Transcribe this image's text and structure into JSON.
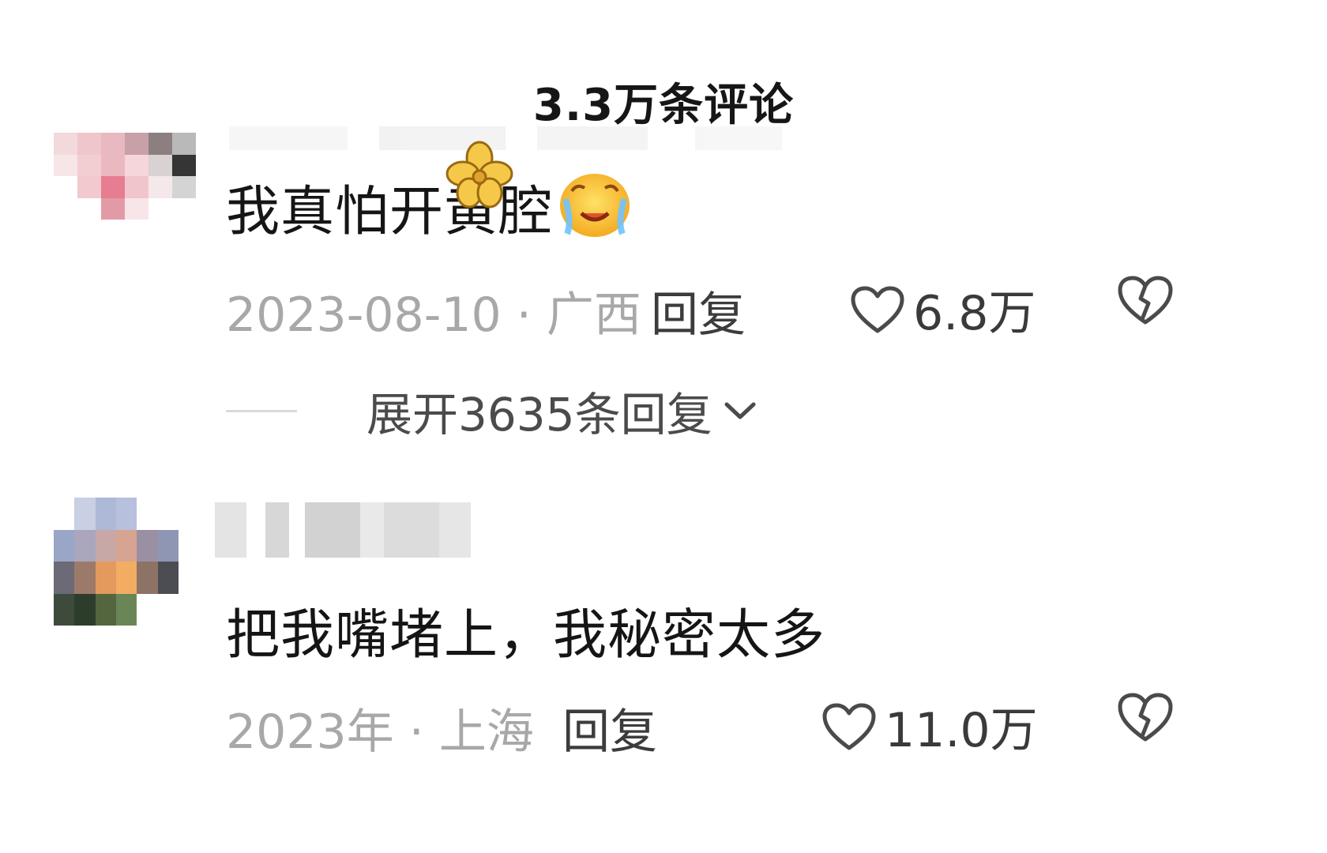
{
  "header": {
    "title": "3.3万条评论"
  },
  "comments": [
    {
      "text": "我真怕开黄腔",
      "date_location": "2023-08-10 · 广西",
      "reply_label": "回复",
      "likes": "6.8万",
      "expand_label": "展开3635条回复"
    },
    {
      "text": "把我嘴堵上，我秘密太多",
      "date_location": "2023年 · 上海",
      "reply_label": "回复",
      "likes": "11.0万"
    }
  ],
  "icons": {
    "like": "heart-outline-icon",
    "dislike": "broken-heart-icon",
    "expand": "chevron-down-icon",
    "emoji_flower": "flower-emoji-icon",
    "emoji_cry": "crying-face-emoji-icon"
  }
}
